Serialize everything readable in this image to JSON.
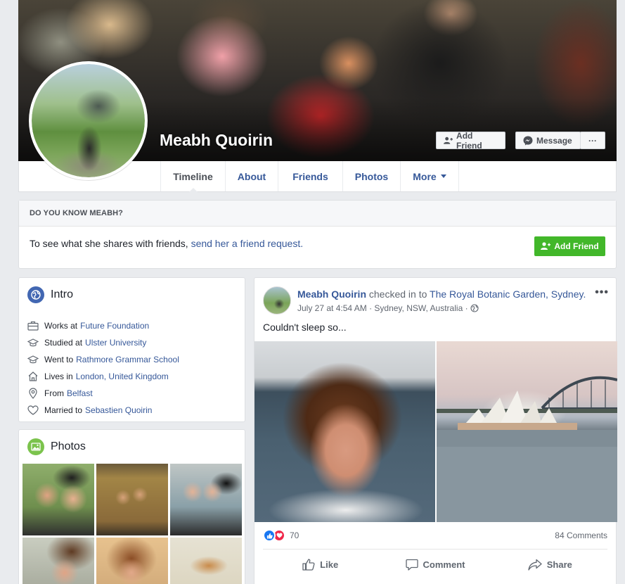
{
  "profile": {
    "name": "Meabh Quoirin"
  },
  "cover_buttons": {
    "add_friend": "Add Friend",
    "message": "Message",
    "more": "···"
  },
  "tabs": [
    {
      "label": "Timeline",
      "active": true
    },
    {
      "label": "About",
      "active": false
    },
    {
      "label": "Friends",
      "active": false
    },
    {
      "label": "Photos",
      "active": false
    },
    {
      "label": "More",
      "active": false
    }
  ],
  "know": {
    "heading": "DO YOU KNOW MEABH?",
    "text": "To see what she shares with friends,",
    "link": "send her a friend request.",
    "button": "Add Friend"
  },
  "intro": {
    "title": "Intro",
    "items": [
      {
        "icon": "briefcase-icon",
        "prefix": "Works at",
        "link": "Future Foundation",
        "link2": ""
      },
      {
        "icon": "graduation-cap-icon",
        "prefix": "Studied at",
        "link": "Ulster University",
        "link2": ""
      },
      {
        "icon": "graduation-cap-icon",
        "prefix": "Went to",
        "link": "Rathmore Grammar School",
        "link2": ""
      },
      {
        "icon": "home-icon",
        "prefix": "Lives in",
        "link": "London, United Kingdom",
        "link2": ""
      },
      {
        "icon": "location-pin-icon",
        "prefix": "From",
        "link": "Belfast",
        "link2": ""
      },
      {
        "icon": "heart-icon",
        "prefix": "Married to",
        "link": "Sebastien Quoirin",
        "link2": ""
      }
    ]
  },
  "photos": {
    "title": "Photos"
  },
  "post": {
    "author": "Meabh Quoirin",
    "action": "checked in to",
    "place": "The Royal Botanic Garden, Sydney.",
    "time": "July 27 at 4:54 AM",
    "location": "Sydney, NSW, Australia",
    "text": "Couldn't sleep so...",
    "reaction_count": "70",
    "comments": "84 Comments",
    "actions": {
      "like": "Like",
      "comment": "Comment",
      "share": "Share"
    }
  },
  "colors": {
    "link": "#365899",
    "green": "#42b72a",
    "like_blue": "#1877f2",
    "love_red": "#f0284a",
    "background": "#e9ebee"
  }
}
